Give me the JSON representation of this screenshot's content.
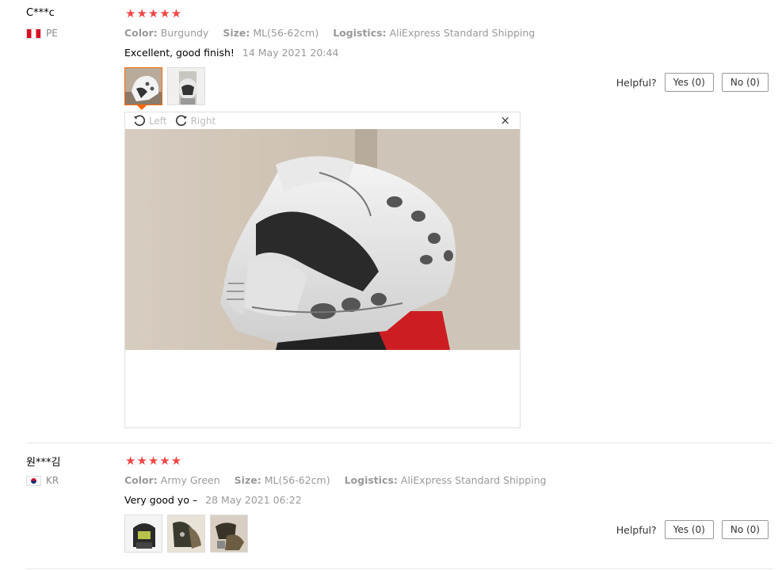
{
  "reviews": [
    {
      "user": "C***c",
      "country_code": "PE",
      "stars": "★★★★★",
      "attributes": [
        {
          "key": "Color:",
          "value": "Burgundy"
        },
        {
          "key": "Size:",
          "value": "ML(56-62cm)"
        },
        {
          "key": "Logistics:",
          "value": "AliExpress Standard Shipping"
        }
      ],
      "text": "Excellent, good finish!",
      "date": "14 May 2021 20:44",
      "helpful_label": "Helpful?",
      "yes_label": "Yes (0)",
      "no_label": "No (0)",
      "viewer": {
        "rotate_left": "Left",
        "rotate_right": "Right",
        "close": "×"
      }
    },
    {
      "user": "원***김",
      "country_code": "KR",
      "stars": "★★★★★",
      "attributes": [
        {
          "key": "Color:",
          "value": "Army Green"
        },
        {
          "key": "Size:",
          "value": "ML(56-62cm)"
        },
        {
          "key": "Logistics:",
          "value": "AliExpress Standard Shipping"
        }
      ],
      "text": "Very good yo –",
      "date": "28 May 2021 06:22",
      "helpful_label": "Helpful?",
      "yes_label": "Yes (0)",
      "no_label": "No (0)"
    }
  ],
  "colors": {
    "star": "#f04646",
    "active_thumb": "#ff6600"
  }
}
